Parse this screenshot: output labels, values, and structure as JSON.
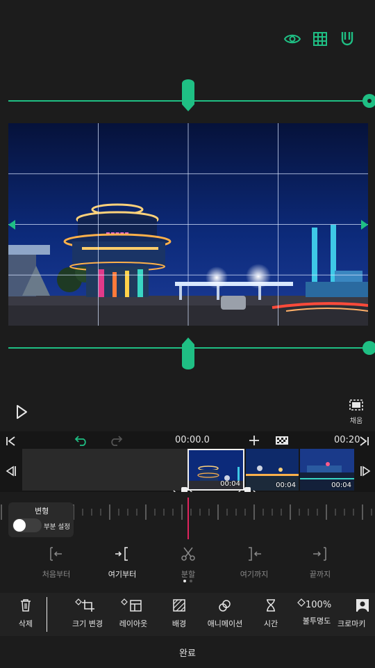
{
  "preview": {
    "icons": [
      "eye-icon",
      "grid-icon",
      "magnet-icon"
    ],
    "fill_label": "채움",
    "play_icon": "play-icon"
  },
  "timeline": {
    "current_time": "00:00.0",
    "total_time": "00:20",
    "clips": [
      {
        "duration": "00:04"
      },
      {
        "duration": "00:04"
      },
      {
        "duration": "00:04"
      }
    ]
  },
  "transform_panel": {
    "title": "변형",
    "toggle_label": "부분 설정",
    "toggle_on": false
  },
  "edit_actions": [
    {
      "label": "처음부터",
      "icon": "trim-start-icon",
      "active": false
    },
    {
      "label": "여기부터",
      "icon": "from-here-icon",
      "active": true
    },
    {
      "label": "분할",
      "icon": "scissors-icon",
      "active": false
    },
    {
      "label": "여기까지",
      "icon": "to-here-icon",
      "active": false
    },
    {
      "label": "끝까지",
      "icon": "trim-end-icon",
      "active": false
    }
  ],
  "toolbar": {
    "delete": "삭제",
    "resize": "크기 변경",
    "layout": "레이아웃",
    "background": "배경",
    "animation": "애니메이션",
    "time": "시간",
    "opacity_value": "100%",
    "opacity": "불투명도",
    "chroma": "크로마키"
  },
  "done": "완료",
  "colors": {
    "accent": "#1fbf84",
    "playhead": "#e0245e"
  }
}
